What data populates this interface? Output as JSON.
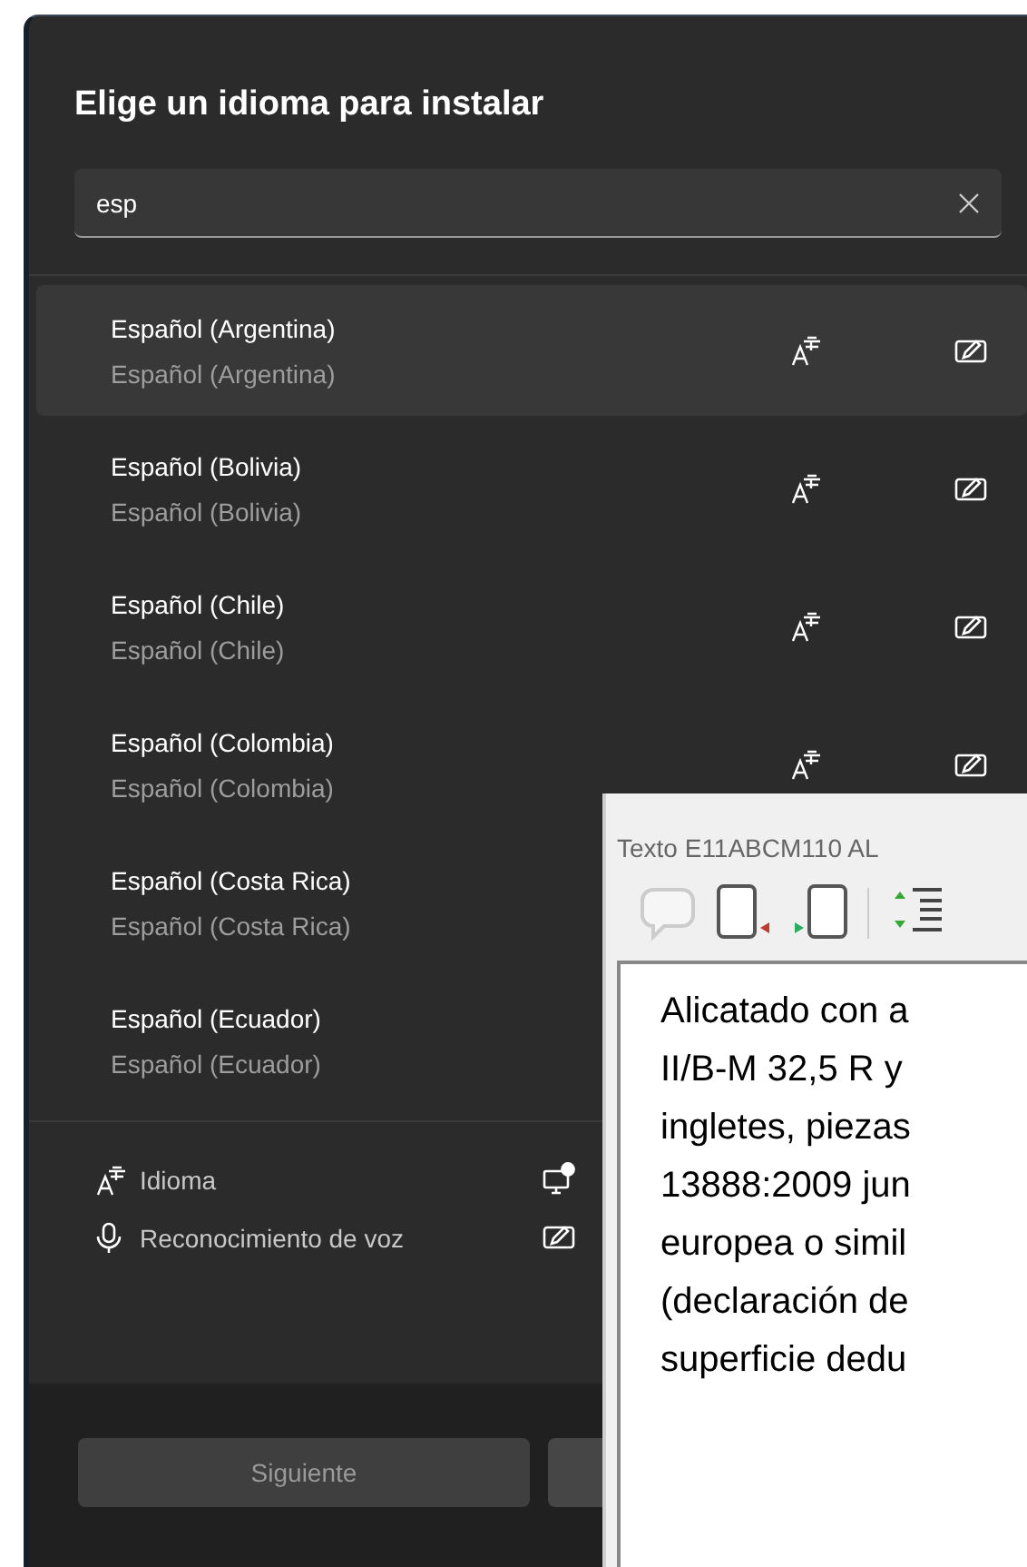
{
  "dialog": {
    "title": "Elige un idioma para instalar",
    "search": {
      "value": "esp"
    },
    "languages": [
      {
        "name": "Español (Argentina)",
        "native": "Español (Argentina)",
        "selected": true
      },
      {
        "name": "Español (Bolivia)",
        "native": "Español (Bolivia)",
        "selected": false
      },
      {
        "name": "Español (Chile)",
        "native": "Español (Chile)",
        "selected": false
      },
      {
        "name": "Español (Colombia)",
        "native": "Español (Colombia)",
        "selected": false
      },
      {
        "name": "Español (Costa Rica)",
        "native": "Español (Costa Rica)",
        "selected": false
      },
      {
        "name": "Español (Ecuador)",
        "native": "Español (Ecuador)",
        "selected": false
      }
    ],
    "features": [
      {
        "kind": "language",
        "label": "Idioma"
      },
      {
        "kind": "speech",
        "label": "Reconocimiento de voz"
      }
    ],
    "buttons": [
      {
        "label": "Siguiente",
        "disabled": true
      }
    ]
  },
  "editor": {
    "title": "Texto E11ABCM110 AL",
    "lines": [
      "Alicatado con a",
      "II/B-M 32,5 R y",
      "ingletes, piezas",
      "13888:2009 jun",
      "europea o simil",
      "(declaración de",
      "superficie dedu"
    ]
  }
}
